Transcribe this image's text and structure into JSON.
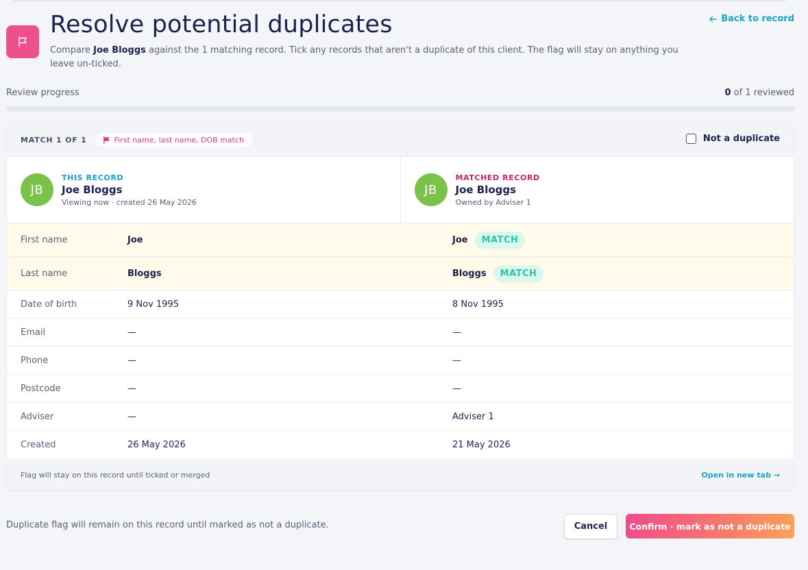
{
  "header": {
    "title": "Resolve potential duplicates",
    "subtitle_prefix": "Compare ",
    "subtitle_client": "Joe Bloggs",
    "subtitle_suffix": " against the 1 matching record. Tick any records that aren't a duplicate of this client. The flag will stay on anything you leave un-ticked.",
    "back_label": "Back to record"
  },
  "progress": {
    "label": "Review progress",
    "reviewed": "0",
    "total_text": " of 1 reviewed",
    "fraction": 0
  },
  "match": {
    "label": "MATCH 1 OF 1",
    "reason": "First name, last name, DOB match",
    "not_duplicate_label": "Not a duplicate",
    "not_duplicate_checked": false,
    "this_record": {
      "tag": "THIS RECORD",
      "initials": "JB",
      "name": "Joe Bloggs",
      "meta": "Viewing now · created 26 May 2026"
    },
    "matched_record": {
      "tag": "MATCHED RECORD",
      "initials": "JB",
      "name": "Joe Bloggs",
      "meta": "Owned by Adviser 1"
    },
    "match_badge": "MATCH",
    "fields": [
      {
        "label": "First name",
        "this": "Joe",
        "matched": "Joe"
      },
      {
        "label": "Last name",
        "this": "Bloggs",
        "matched": "Bloggs"
      },
      {
        "label": "Date of birth",
        "this": "9 Nov 1995",
        "matched": "8 Nov 1995"
      },
      {
        "label": "Email",
        "this": "—",
        "matched": "—"
      },
      {
        "label": "Phone",
        "this": "—",
        "matched": "—"
      },
      {
        "label": "Postcode",
        "this": "—",
        "matched": "—"
      },
      {
        "label": "Adviser",
        "this": "—",
        "matched": "Adviser 1"
      },
      {
        "label": "Created",
        "this": "26 May 2026",
        "matched": "21 May 2026"
      }
    ],
    "footer_note": "Flag will stay on this record until ticked or merged",
    "open_tab_label": "Open in new tab →"
  },
  "actions": {
    "note": "Duplicate flag will remain on this record until marked as not a duplicate.",
    "cancel_label": "Cancel",
    "confirm_label": "Confirm · mark as not a duplicate"
  },
  "colors": {
    "accent": "#1aa3c9",
    "flag": "#ee4f8d",
    "match_badge_text": "#2ec5a0",
    "avatar": "#7bc24a"
  },
  "icons": {
    "header": "flag-icon",
    "back": "arrow-left-icon",
    "reason": "flag-icon"
  }
}
